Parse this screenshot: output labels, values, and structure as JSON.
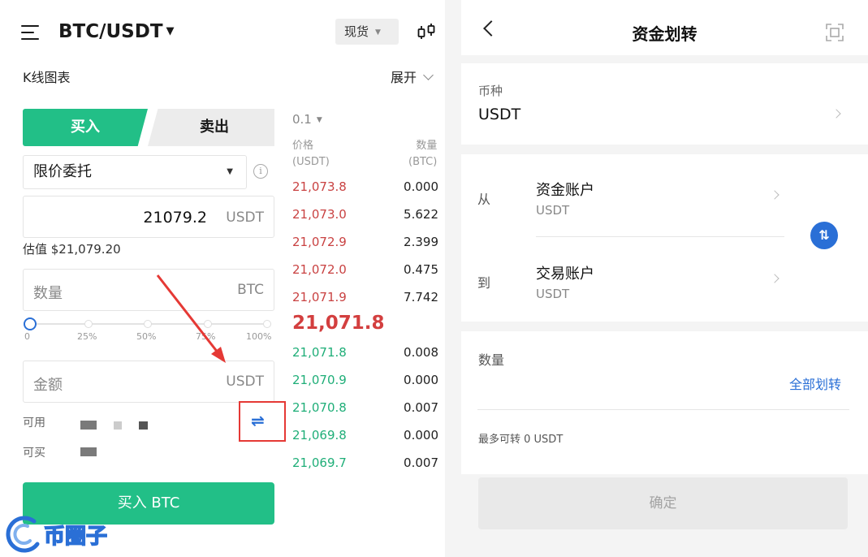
{
  "trade": {
    "pair": "BTC/USDT",
    "market_type": "现货",
    "kline_label": "K线图表",
    "expand_label": "展开",
    "buy_tab": "买入",
    "sell_tab": "卖出",
    "order_type": "限价委托",
    "price_value": "21079.2",
    "price_unit": "USDT",
    "estimate": "估值 $21,079.20",
    "quantity_placeholder": "数量",
    "quantity_unit": "BTC",
    "slider_marks": [
      "0",
      "25%",
      "50%",
      "75%",
      "100%"
    ],
    "slider_value_percent": 0,
    "amount_placeholder": "金额",
    "amount_unit": "USDT",
    "available_label": "可用",
    "buyable_label": "可买",
    "buy_button": "买入 BTC",
    "swap_icon": "swap-arrows-icon"
  },
  "orderbook": {
    "depth": "0.1",
    "price_header": "价格",
    "price_header_unit": "(USDT)",
    "qty_header": "数量",
    "qty_header_unit": "(BTC)",
    "asks": [
      {
        "price": "21,073.8",
        "qty": "0.000"
      },
      {
        "price": "21,073.0",
        "qty": "5.622"
      },
      {
        "price": "21,072.9",
        "qty": "2.399"
      },
      {
        "price": "21,072.0",
        "qty": "0.475"
      },
      {
        "price": "21,071.9",
        "qty": "7.742"
      }
    ],
    "last_price": "21,071.8",
    "bids": [
      {
        "price": "21,071.8",
        "qty": "0.008"
      },
      {
        "price": "21,070.9",
        "qty": "0.000"
      },
      {
        "price": "21,070.8",
        "qty": "0.007"
      },
      {
        "price": "21,069.8",
        "qty": "0.000"
      },
      {
        "price": "21,069.7",
        "qty": "0.007"
      }
    ]
  },
  "transfer": {
    "title": "资金划转",
    "coin_label": "币种",
    "coin_value": "USDT",
    "from_label": "从",
    "from_account": "资金账户",
    "from_unit": "USDT",
    "to_label": "到",
    "to_account": "交易账户",
    "to_unit": "USDT",
    "amount_label": "数量",
    "transfer_all": "全部划转",
    "max_transfer": "最多可转 0 USDT",
    "confirm": "确定"
  },
  "watermark": "币圈子",
  "colors": {
    "buy_green": "#22bf87",
    "ask_red": "#c94242",
    "bid_green": "#1fae78",
    "accent_blue": "#2a6fd6",
    "highlight_red": "#e53935"
  }
}
